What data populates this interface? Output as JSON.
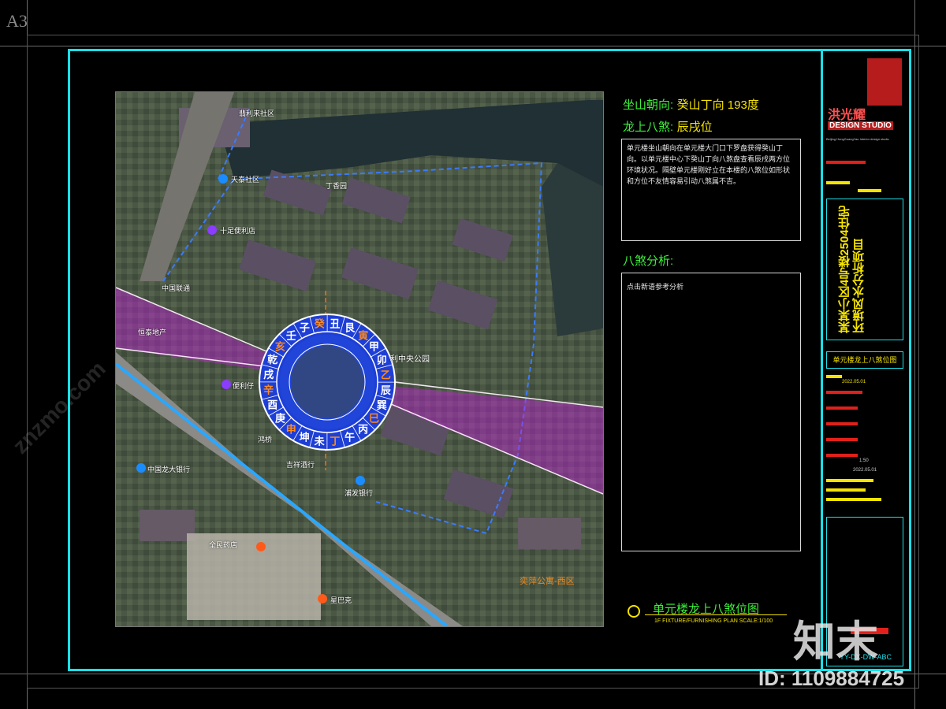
{
  "sheet_size": "A3",
  "map": {
    "labels": [
      {
        "text": "翡利来社区"
      },
      {
        "text": "天泰社区"
      },
      {
        "text": "丁香园"
      },
      {
        "text": "十足便利店"
      },
      {
        "text": "中国联通"
      },
      {
        "text": "恒泰地产"
      },
      {
        "text": "利中央公园"
      },
      {
        "text": "便利仔"
      },
      {
        "text": "鸿桥"
      },
      {
        "text": "中国龙大银行"
      },
      {
        "text": "吉祥酒行"
      },
      {
        "text": "浦发银行"
      },
      {
        "text": "全民药店"
      },
      {
        "text": "星巴克"
      }
    ],
    "district_label": "奕萍公寓-西区",
    "compass_outer": [
      "癸",
      "丑",
      "艮",
      "寅",
      "甲",
      "卯",
      "乙",
      "辰",
      "巽",
      "巳",
      "丙",
      "午",
      "丁",
      "未",
      "坤",
      "申",
      "庚",
      "酉",
      "辛",
      "戌",
      "乾",
      "亥",
      "壬",
      "子"
    ]
  },
  "info": {
    "orientation_label": "坐山朝向:",
    "orientation_value": "癸山丁向 193度",
    "basha_label": "龙上八煞:",
    "basha_value": "辰戌位",
    "description": "单元楼坐山朝向在单元楼大门口下罗盘获得癸山丁向。以单元楼中心下癸山丁向八煞盘查看辰戌两方位环境状况。隔壁单元楼刚好立在本楼的八煞位如形状和方位不友情容易引动八煞属不吉。",
    "analysis_label": "八煞分析:",
    "analysis_placeholder": "点击新语参考分析"
  },
  "plan_title": {
    "title": "单元楼龙上八煞位图",
    "subtitle": "1F FIXTURE/FURNISHING PLAN  SCALE:1/100"
  },
  "title_block": {
    "studio_top": "洪光耀",
    "studio_name": "DESIGN STUDIO",
    "studio_sub": "Beijing HongGuangYao Interior design studio",
    "project_title": "某某小区4号楼2504住宅环境风水分析项目",
    "drawing_name": "单元楼龙上八煞位图",
    "date1": "2022.05.01",
    "scale": "1:50",
    "date2": "2022.05.01",
    "drawing_code": "YY-DX-DW-ABC"
  },
  "watermark": {
    "brand": "知末",
    "id_text": "ID: 1109884725",
    "site": "znzmo.com"
  },
  "colors": {
    "cyan": "#19e0e8",
    "yellow": "#f5e400",
    "green": "#3cf03a",
    "compass_blue": "#1e3fd6",
    "sector_magenta": "#c41fd8"
  }
}
